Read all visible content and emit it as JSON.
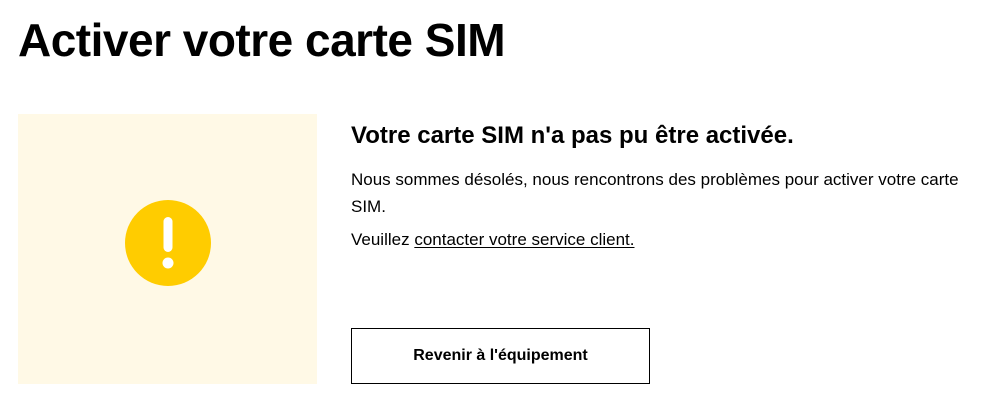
{
  "page": {
    "title": "Activer votre carte SIM"
  },
  "illustration": {
    "background_color": "#fff9e6",
    "icon": "exclamation-circle-icon",
    "icon_color": "#ffcc00"
  },
  "status": {
    "heading": "Votre carte SIM n'a pas pu être activée.",
    "message": "Nous sommes désolés, nous rencontrons des problèmes pour activer votre carte SIM.",
    "contact_prefix": "Veuillez ",
    "contact_link": "contacter votre service client."
  },
  "actions": {
    "back_label": "Revenir à l'équipement"
  }
}
